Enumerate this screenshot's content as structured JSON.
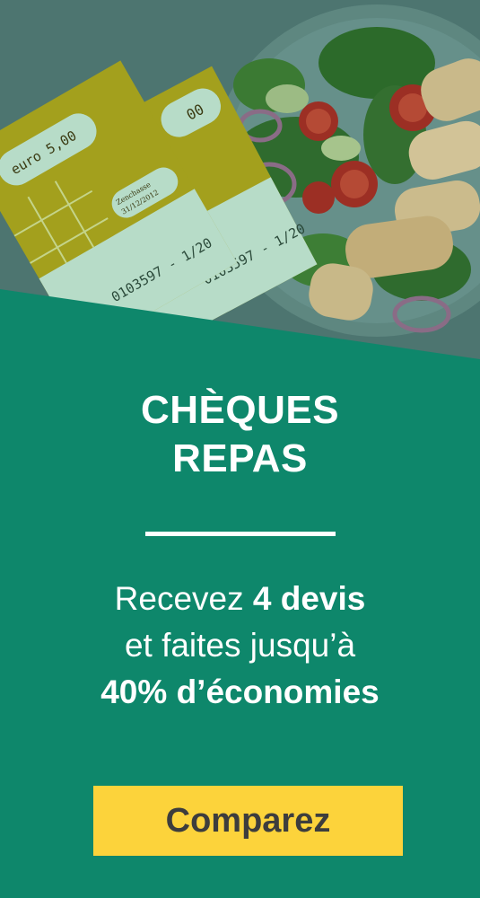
{
  "colors": {
    "panel_green": "#0e876b",
    "button_yellow": "#fcd33b",
    "button_text": "#3d3d3d",
    "text_white": "#ffffff",
    "cheque_green": "#a3a01d",
    "cheque_mint": "#b7dcc8"
  },
  "hero": {
    "cheque_amount": "euro 5,00",
    "cheque_amount_back": "00",
    "cheque_number": "0103597 - 1/20",
    "cheque_small_label": "Zenchasse",
    "cheque_date": "31/12/2012"
  },
  "title": {
    "line1": "CHÈQUES",
    "line2": "REPAS"
  },
  "offer": {
    "line1_regular": "Recevez ",
    "line1_bold": "4 devis",
    "line2": "et faites jusqu’à",
    "line3_bold": "40% d’économies"
  },
  "cta": {
    "label": "Comparez"
  }
}
